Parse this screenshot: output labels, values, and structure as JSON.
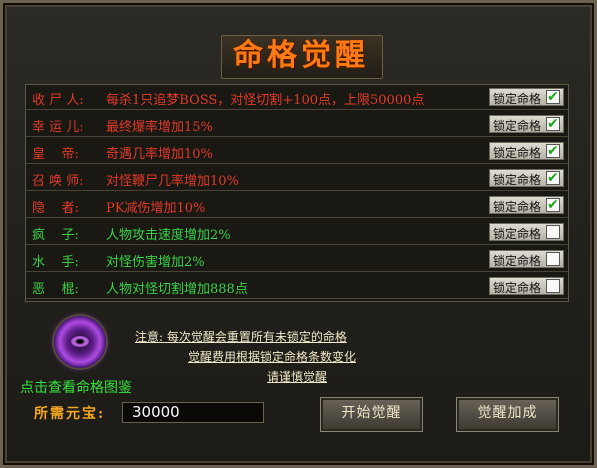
{
  "dialog": {
    "title": "命格觉醒",
    "lock_label": "锁定命格"
  },
  "fates": [
    {
      "name": "收 尸 人:",
      "desc": "每杀1只追梦BOSS，对怪切割+100点，上限50000点",
      "color": "red",
      "locked": true
    },
    {
      "name": "幸 运 儿:",
      "desc": "最终爆率增加15%",
      "color": "red",
      "locked": true
    },
    {
      "name": "皇    帝:",
      "desc": "奇遇几率增加10%",
      "color": "red",
      "locked": true
    },
    {
      "name": "召 唤 师:",
      "desc": "对怪鞭尸几率增加10%",
      "color": "red",
      "locked": true
    },
    {
      "name": "隐    者:",
      "desc": "PK减伤增加10%",
      "color": "red",
      "locked": true
    },
    {
      "name": "疯    子:",
      "desc": "人物攻击速度增加2%",
      "color": "green",
      "locked": false
    },
    {
      "name": "水    手:",
      "desc": "对怪伤害增加2%",
      "color": "green",
      "locked": false
    },
    {
      "name": "恶    棍:",
      "desc": "人物对怪切割增加888点",
      "color": "green",
      "locked": false
    }
  ],
  "view_link": "点击查看命格图鉴",
  "notice": {
    "line1": "注意: 每次觉醒会重置所有未锁定的命格",
    "line2": "觉醒费用根据锁定命格条数变化",
    "line3": "请谨慎觉醒"
  },
  "cost": {
    "label": "所需元宝:",
    "value": "30000"
  },
  "buttons": {
    "start": "开始觉醒",
    "bonus": "觉醒加成"
  },
  "icons": {
    "orb": "fate-orb-icon",
    "check": "checkmark-icon"
  }
}
